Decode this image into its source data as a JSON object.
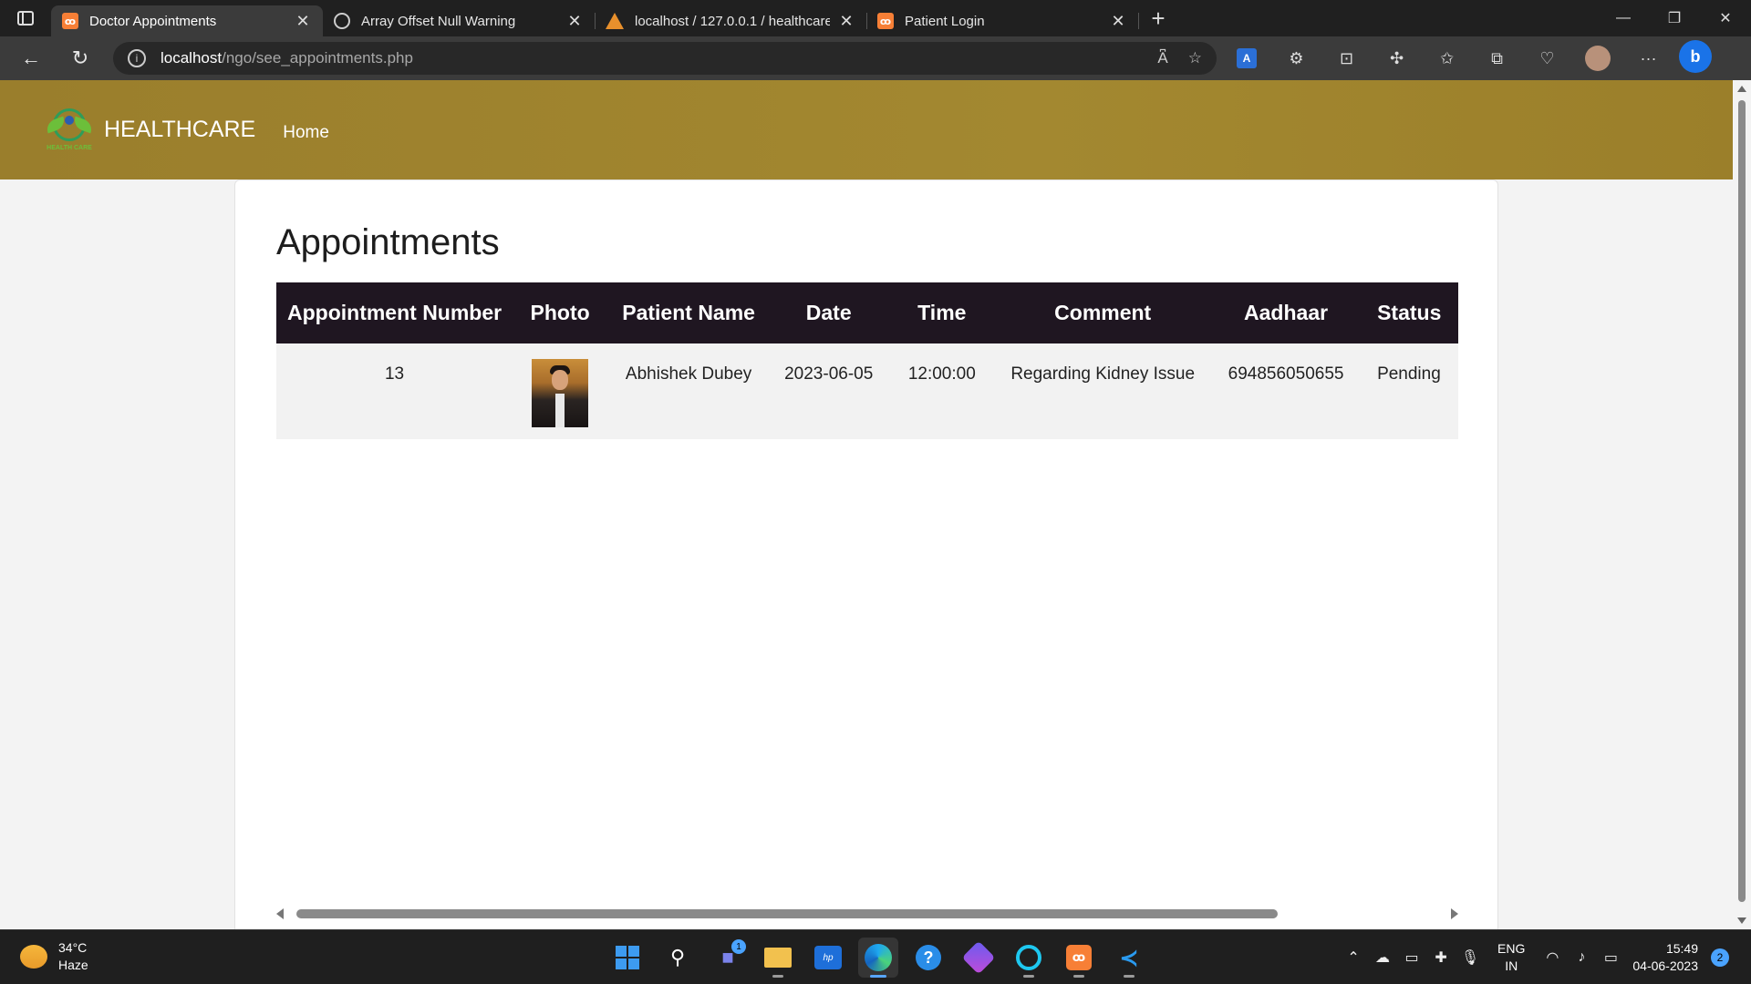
{
  "browser": {
    "tabs": [
      {
        "title": "Doctor Appointments",
        "favicon": "xampp-icon",
        "active": true
      },
      {
        "title": "Array Offset Null Warning",
        "favicon": "chatgpt-icon",
        "active": false
      },
      {
        "title": "localhost / 127.0.0.1 / healthcare",
        "favicon": "phpmyadmin-icon",
        "active": false
      },
      {
        "title": "Patient Login",
        "favicon": "xampp-icon",
        "active": false
      }
    ],
    "url_host": "localhost",
    "url_path": "/ngo/see_appointments.php"
  },
  "site": {
    "brand": "HEALTHCARE",
    "logo_text": "HEALTH CARE",
    "nav_home": "Home",
    "nav_color": "#a38830"
  },
  "page": {
    "title": "Appointments",
    "table": {
      "headers": [
        "Appointment Number",
        "Photo",
        "Patient Name",
        "Date",
        "Time",
        "Comment",
        "Aadhaar",
        "Status"
      ],
      "rows": [
        {
          "appointment_number": "13",
          "patient_name": "Abhishek Dubey",
          "date": "2023-06-05",
          "time": "12:00:00",
          "comment": "Regarding Kidney Issue",
          "aadhaar": "694856050655",
          "status": "Pending"
        }
      ]
    }
  },
  "taskbar": {
    "weather_temp": "34°C",
    "weather_desc": "Haze",
    "chat_badge": "1",
    "lang_top": "ENG",
    "lang_bottom": "IN",
    "time": "15:49",
    "date": "04-06-2023",
    "notifications": "2"
  }
}
